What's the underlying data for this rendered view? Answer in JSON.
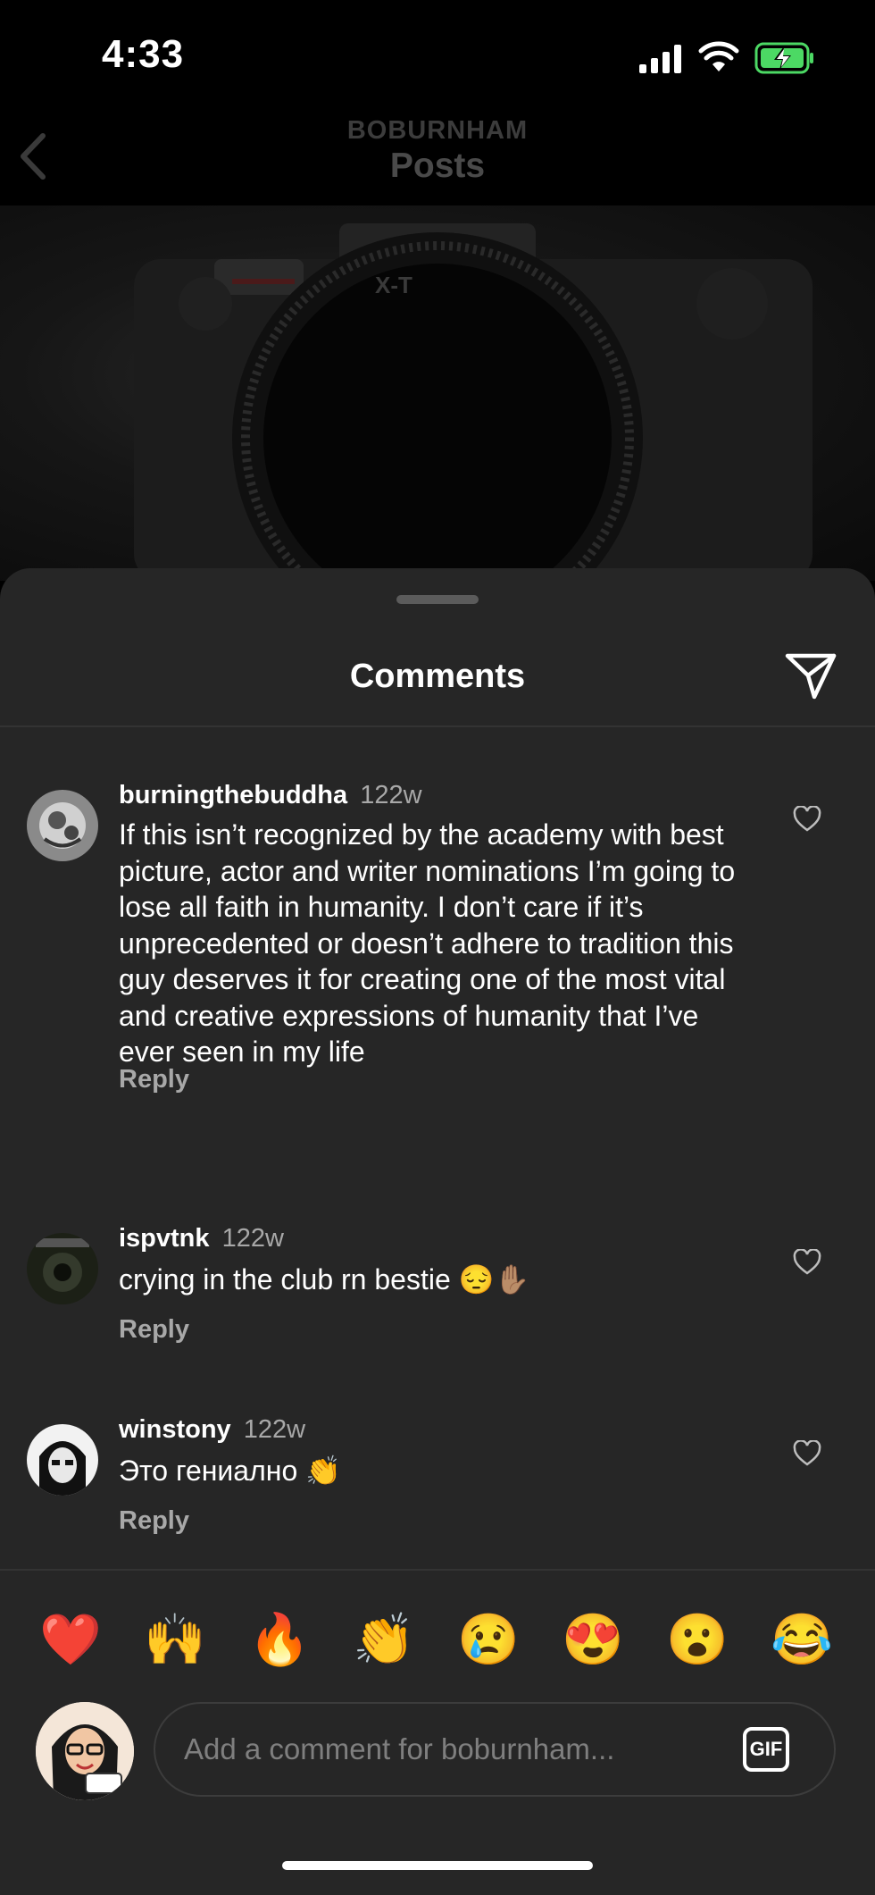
{
  "status_bar": {
    "time": "4:33",
    "battery_color": "#4cd964"
  },
  "header": {
    "subtitle": "BOBURNHAM",
    "title": "Posts"
  },
  "sheet": {
    "title": "Comments"
  },
  "comments": [
    {
      "username": "burningthebuddha",
      "time": "122w",
      "text": "If this isn’t recognized by the academy with best picture, actor and writer nominations I’m going to lose all faith in humanity. I don’t care if it’s unprecedented or doesn’t adhere to tradition this guy deserves it for creating one of the most vital and creative expressions of humanity that I’ve ever seen in my life",
      "reply": "Reply"
    },
    {
      "username": "ispvtnk",
      "time": "122w",
      "text": "crying in the club rn bestie 😔✋🏽",
      "reply": "Reply"
    },
    {
      "username": "winstony",
      "time": "122w",
      "text": "Это гениално 👏",
      "reply": "Reply"
    }
  ],
  "quick_emojis": [
    "❤️",
    "🙌",
    "🔥",
    "👏",
    "😢",
    "😍",
    "😮",
    "😂"
  ],
  "composer": {
    "placeholder": "Add a comment for boburnham...",
    "gif_label": "GIF"
  },
  "icons": {
    "back": "chevron-left-icon",
    "share": "paper-plane-icon",
    "like": "heart-outline-icon"
  }
}
